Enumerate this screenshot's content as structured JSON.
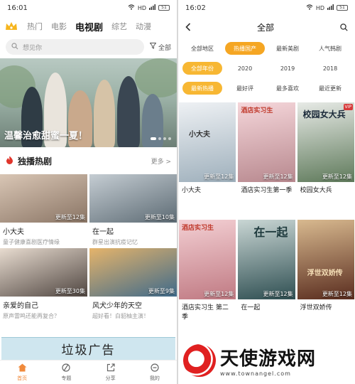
{
  "left": {
    "status": {
      "time": "16:01",
      "icons": "HD",
      "battery": "51"
    },
    "nav": {
      "tabs": [
        "热门",
        "电影",
        "电视剧",
        "综艺",
        "动漫"
      ],
      "active": 2
    },
    "search": {
      "placeholder": "想见你",
      "filter": "全部"
    },
    "banner": {
      "title": "温馨治愈甜蜜一夏！"
    },
    "section": {
      "title": "独播热剧",
      "more": "更多 >"
    },
    "cards": [
      {
        "name": "小大夫",
        "desc": "童子健康喜剧医疗情缘",
        "update": "更新至12集",
        "colors": [
          "#d9c6b5",
          "#8a7565"
        ]
      },
      {
        "name": "在一起",
        "desc": "群星出演抗疫记忆",
        "update": "更新至10集",
        "colors": [
          "#c5cdd3",
          "#5d6b74"
        ]
      },
      {
        "name": "亲爱的自己",
        "desc": "原声雷鸣还能再复合？",
        "update": "更新至30集",
        "colors": [
          "#e8dcd0",
          "#4f4540"
        ]
      },
      {
        "name": "风犬少年的天空",
        "desc": "超好看！白貂柚主演！",
        "update": "更新至9集",
        "colors": [
          "#e5b46b",
          "#3f6a8a"
        ]
      }
    ],
    "ad": "垃圾广告",
    "tabbar": [
      "首页",
      "专题",
      "分享",
      "我的"
    ]
  },
  "right": {
    "status": {
      "time": "16:02",
      "icons": "HD",
      "battery": "51"
    },
    "title": "全部",
    "filters": [
      [
        "全部地区",
        "热播国产",
        "最新美剧",
        "人气韩剧"
      ],
      [
        "全部年份",
        "2020",
        "2019",
        "2018"
      ],
      [
        "最新热播",
        "最好评",
        "最多喜欢",
        "最近更新"
      ]
    ],
    "selected": [
      1,
      0,
      0
    ],
    "posters": [
      {
        "name": "小大夫",
        "update": "更新至12集",
        "poster_text": "小大夫",
        "colors": [
          "#eef1f4",
          "#9fb0bc"
        ]
      },
      {
        "name": "酒店实习生第一季",
        "update": "更新至12集",
        "poster_text": "酒店实习生",
        "colors": [
          "#f5d6da",
          "#b8898f"
        ]
      },
      {
        "name": "校园女大兵",
        "update": "更新至12集",
        "poster_text": "校园女大兵",
        "colors": [
          "#e7eae6",
          "#5f7a5b"
        ],
        "vip": "VIP"
      },
      {
        "name": "酒店实习生 第二季",
        "update": "更新至12集",
        "poster_text": "酒店实习生",
        "colors": [
          "#f3cfd3",
          "#c07a83"
        ]
      },
      {
        "name": "在一起",
        "update": "更新至12集",
        "poster_text": "在一起",
        "colors": [
          "#c9d6d4",
          "#2f4f52"
        ]
      },
      {
        "name": "浮世双娇传",
        "update": "更新至12集",
        "poster_text": "浮世双娇传",
        "colors": [
          "#d8b98f",
          "#5a2d1f"
        ]
      }
    ]
  },
  "watermark": {
    "name": "天使游戏网",
    "url": "www.townangel.com"
  }
}
